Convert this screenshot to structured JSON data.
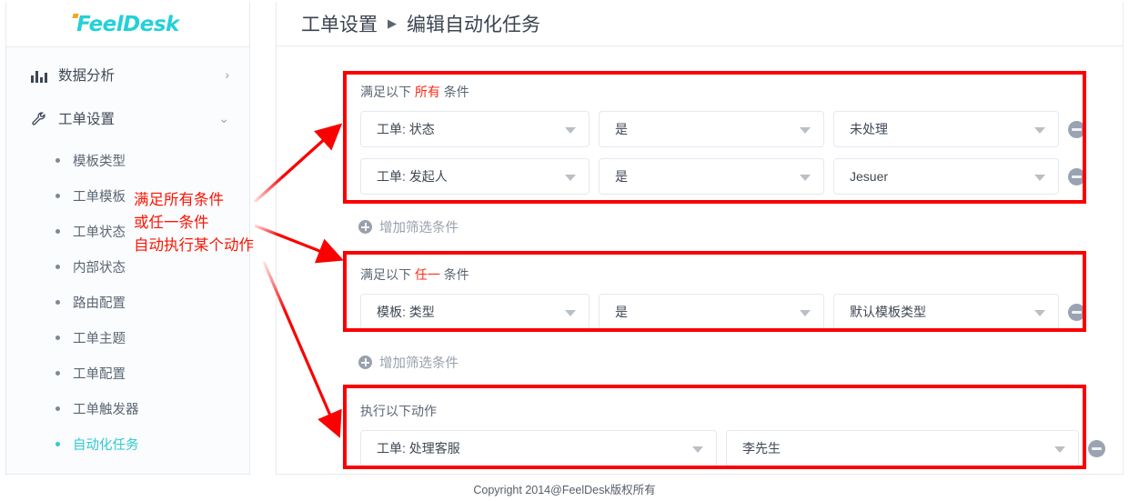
{
  "brand": {
    "name": "FeelDesk",
    "color": "#2ec9d1",
    "accent_color": "#f5a623"
  },
  "sidebar": {
    "nav": [
      {
        "label": "数据分析",
        "icon": "bar-chart-icon",
        "arrow": "›",
        "expanded": false
      },
      {
        "label": "工单设置",
        "icon": "wrench-icon",
        "arrow": "⌄",
        "expanded": true
      }
    ],
    "sub_items": [
      {
        "label": "模板类型",
        "active": false
      },
      {
        "label": "工单模板",
        "active": false
      },
      {
        "label": "工单状态",
        "active": false
      },
      {
        "label": "内部状态",
        "active": false
      },
      {
        "label": "路由配置",
        "active": false
      },
      {
        "label": "工单主题",
        "active": false
      },
      {
        "label": "工单配置",
        "active": false
      },
      {
        "label": "工单触发器",
        "active": false
      },
      {
        "label": "自动化任务",
        "active": true
      }
    ]
  },
  "breadcrumb": {
    "parent": "工单设置",
    "separator": "▶",
    "current": "编辑自动化任务"
  },
  "conditions_all": {
    "label_prefix": "满足以下",
    "label_highlight": "所有",
    "label_suffix": "条件",
    "highlight_color": "#ff2a18",
    "rows": [
      {
        "field": "工单: 状态",
        "operator": "是",
        "value": "未处理",
        "remove": "remove-condition"
      },
      {
        "field": "工单: 发起人",
        "operator": "是",
        "value": "Jesuer",
        "remove": "remove-condition"
      }
    ],
    "add_label": "增加筛选条件"
  },
  "conditions_any": {
    "label_prefix": "满足以下",
    "label_highlight": "任一",
    "label_suffix": "条件",
    "rows": [
      {
        "field": "模板: 类型",
        "operator": "是",
        "value": "默认模板类型",
        "remove": "remove-condition"
      }
    ],
    "add_label": "增加筛选条件"
  },
  "actions": {
    "label": "执行以下动作",
    "rows": [
      {
        "field": "工单: 处理客服",
        "value": "李先生",
        "remove": "remove-action"
      }
    ]
  },
  "annotation": {
    "color": "#fa1505",
    "lines": [
      "满足所有条件",
      "或任一条件",
      "自动执行某个动作"
    ]
  },
  "footer": {
    "text": "Copyright 2014@FeelDesk版权所有"
  }
}
